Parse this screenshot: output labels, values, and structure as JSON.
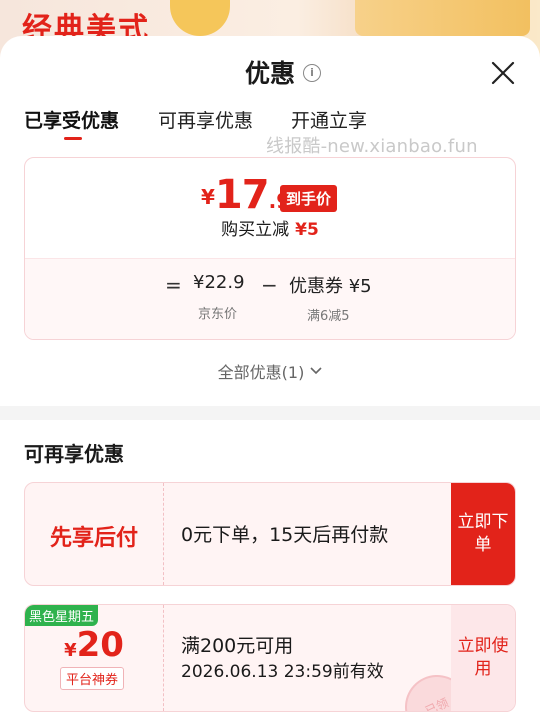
{
  "background": {
    "promo_title": "经典美式"
  },
  "sheet": {
    "title": "优惠",
    "info_icon": "info-icon",
    "close_icon": "close-icon"
  },
  "tabs": [
    {
      "label": "已享受优惠",
      "active": true
    },
    {
      "label": "可再享优惠",
      "active": false
    },
    {
      "label": "开通立享",
      "active": false
    }
  ],
  "watermark": "线报酷-new.xianbao.fun",
  "price_summary": {
    "currency": "¥",
    "final_int": "17",
    "final_dec": ".9",
    "final_badge": "到手价",
    "reduce_label": "购买立减",
    "reduce_amount": "¥5",
    "equals": "=",
    "jd_price": "¥22.9",
    "jd_price_label": "京东价",
    "minus": "−",
    "coupon_label": "优惠券 ¥5",
    "coupon_rule": "满6减5"
  },
  "all_offers": {
    "label": "全部优惠(1)"
  },
  "section": {
    "title": "可再享优惠"
  },
  "offers": [
    {
      "left_label": "先享后付",
      "desc": "0元下单，15天后再付款",
      "button": "立即下单"
    },
    {
      "tag": "黑色星期五",
      "currency": "¥",
      "amount": "20",
      "platform_tag": "平台神券",
      "desc": "满200元可用",
      "validity": "2026.06.13 23:59前有效",
      "button": "立即使用",
      "stamp": "已领"
    }
  ],
  "colors": {
    "accent": "#e2231a",
    "card_border": "#f6d3d6",
    "card_bg": "#fff4f4",
    "tag_green": "#2fb24d"
  }
}
